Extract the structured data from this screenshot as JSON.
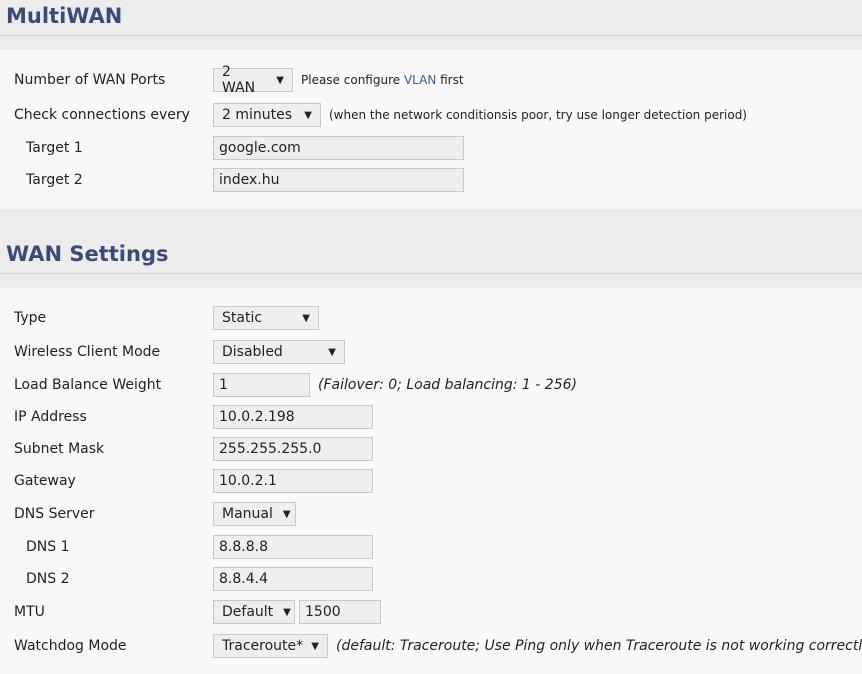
{
  "multiwan": {
    "title": "MultiWAN",
    "wan_ports": {
      "label": "Number of WAN Ports",
      "value": "2 WAN",
      "note_prefix": "Please configure ",
      "note_link": "VLAN",
      "note_suffix": " first"
    },
    "check_every": {
      "label": "Check connections every",
      "value": "2 minutes",
      "note": "(when the network conditionsis poor, try use longer detection period)"
    },
    "target1": {
      "label": "Target 1",
      "value": "google.com"
    },
    "target2": {
      "label": "Target 2",
      "value": "index.hu"
    }
  },
  "wan": {
    "title": "WAN Settings",
    "type": {
      "label": "Type",
      "value": "Static"
    },
    "wireless_client": {
      "label": "Wireless Client Mode",
      "value": "Disabled"
    },
    "lb_weight": {
      "label": "Load Balance Weight",
      "value": "1",
      "hint": "(Failover: 0; Load balancing: 1 - 256)"
    },
    "ip": {
      "label": "IP Address",
      "value": "10.0.2.198"
    },
    "mask": {
      "label": "Subnet Mask",
      "value": "255.255.255.0"
    },
    "gateway": {
      "label": "Gateway",
      "value": "10.0.2.1"
    },
    "dns_server": {
      "label": "DNS Server",
      "value": "Manual"
    },
    "dns1": {
      "label": "DNS 1",
      "value": "8.8.8.8"
    },
    "dns2": {
      "label": "DNS 2",
      "value": "8.8.4.4"
    },
    "mtu": {
      "label": "MTU",
      "mode": "Default",
      "value": "1500"
    },
    "watchdog": {
      "label": "Watchdog Mode",
      "value": "Traceroute*",
      "hint": "(default: Traceroute; Use Ping only when Traceroute is not working correctly"
    }
  },
  "icons": {
    "dropdown": "▼"
  }
}
